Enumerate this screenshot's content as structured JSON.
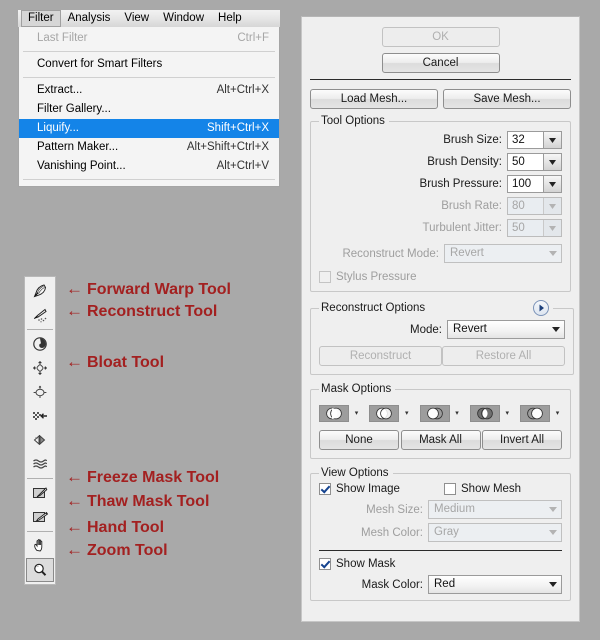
{
  "menu": {
    "bar_items": [
      {
        "label": "Filter",
        "active": true
      },
      {
        "label": "Analysis",
        "active": false
      },
      {
        "label": "View",
        "active": false
      },
      {
        "label": "Window",
        "active": false
      },
      {
        "label": "Help",
        "active": false
      }
    ],
    "items": [
      {
        "label": "Last Filter",
        "shortcut": "Ctrl+F",
        "state": "disabled"
      },
      {
        "label": "Convert for Smart Filters",
        "shortcut": "",
        "state": "normal"
      },
      {
        "label": "Extract...",
        "shortcut": "Alt+Ctrl+X",
        "state": "normal"
      },
      {
        "label": "Filter Gallery...",
        "shortcut": "",
        "state": "normal"
      },
      {
        "label": "Liquify...",
        "shortcut": "Shift+Ctrl+X",
        "state": "selected"
      },
      {
        "label": "Pattern Maker...",
        "shortcut": "Alt+Shift+Ctrl+X",
        "state": "normal"
      },
      {
        "label": "Vanishing Point...",
        "shortcut": "Alt+Ctrl+V",
        "state": "normal"
      }
    ]
  },
  "tools": [
    {
      "icon": "forward-warp-tool-icon",
      "name": "Forward Warp Tool",
      "selected": false
    },
    {
      "icon": "reconstruct-tool-icon",
      "name": "Reconstruct Tool",
      "selected": false
    },
    {
      "icon": "twirl-clockwise-tool-icon",
      "name": "Twirl Clockwise Tool",
      "selected": false
    },
    {
      "icon": "pucker-tool-icon",
      "name": "Pucker Tool",
      "selected": false
    },
    {
      "icon": "bloat-tool-icon",
      "name": "Bloat Tool",
      "selected": false
    },
    {
      "icon": "push-left-tool-icon",
      "name": "Push Left Tool",
      "selected": false
    },
    {
      "icon": "mirror-tool-icon",
      "name": "Mirror Tool",
      "selected": false
    },
    {
      "icon": "turbulence-tool-icon",
      "name": "Turbulence Tool",
      "selected": false
    },
    {
      "icon": "freeze-mask-tool-icon",
      "name": "Freeze Mask Tool",
      "selected": false
    },
    {
      "icon": "thaw-mask-tool-icon",
      "name": "Thaw Mask Tool",
      "selected": false
    },
    {
      "icon": "hand-tool-icon",
      "name": "Hand Tool",
      "selected": false
    },
    {
      "icon": "zoom-tool-icon",
      "name": "Zoom Tool",
      "selected": true
    }
  ],
  "annotations": [
    {
      "arrow": "←",
      "label": "Forward Warp Tool"
    },
    {
      "arrow": "←",
      "label": "Reconstruct Tool"
    },
    {
      "arrow": "←",
      "label": "Bloat Tool"
    },
    {
      "arrow": "←",
      "label": "Freeze Mask Tool"
    },
    {
      "arrow": "←",
      "label": "Thaw Mask Tool"
    },
    {
      "arrow": "←",
      "label": "Hand Tool"
    },
    {
      "arrow": "←",
      "label": "Zoom Tool"
    }
  ],
  "panel": {
    "ok_label": "OK",
    "cancel_label": "Cancel",
    "load_mesh_label": "Load Mesh...",
    "save_mesh_label": "Save Mesh...",
    "tool_options": {
      "legend": "Tool Options",
      "fields": [
        {
          "label": "Brush Size:",
          "value": "32",
          "disabled": false
        },
        {
          "label": "Brush Density:",
          "value": "50",
          "disabled": false
        },
        {
          "label": "Brush Pressure:",
          "value": "100",
          "disabled": false
        },
        {
          "label": "Brush Rate:",
          "value": "80",
          "disabled": true
        },
        {
          "label": "Turbulent Jitter:",
          "value": "50",
          "disabled": true
        }
      ],
      "reconstruct_mode_label": "Reconstruct Mode:",
      "reconstruct_mode_value": "Revert",
      "stylus_pressure_label": "Stylus Pressure",
      "stylus_pressure_checked": false
    },
    "reconstruct_options": {
      "legend": "Reconstruct Options",
      "mode_label": "Mode:",
      "mode_value": "Revert",
      "reconstruct_label": "Reconstruct",
      "restore_all_label": "Restore All"
    },
    "mask_options": {
      "legend": "Mask Options",
      "icons": [
        "mask-replace-selection-icon",
        "mask-add-to-selection-icon",
        "mask-subtract-from-selection-icon",
        "mask-intersect-with-selection-icon",
        "mask-invert-selection-icon"
      ],
      "none_label": "None",
      "mask_all_label": "Mask All",
      "invert_all_label": "Invert All"
    },
    "view_options": {
      "legend": "View Options",
      "show_image_label": "Show Image",
      "show_image_checked": true,
      "show_mesh_label": "Show Mesh",
      "show_mesh_checked": false,
      "mesh_size_label": "Mesh Size:",
      "mesh_size_value": "Medium",
      "mesh_color_label": "Mesh Color:",
      "mesh_color_value": "Gray",
      "show_mask_label": "Show Mask",
      "show_mask_checked": true,
      "mask_color_label": "Mask Color:",
      "mask_color_value": "Red"
    }
  },
  "colors": {
    "annotation_red": "#a32020",
    "menu_highlight": "#1484e8",
    "app_background": "#a9a9a9",
    "panel_background": "#efefef"
  }
}
